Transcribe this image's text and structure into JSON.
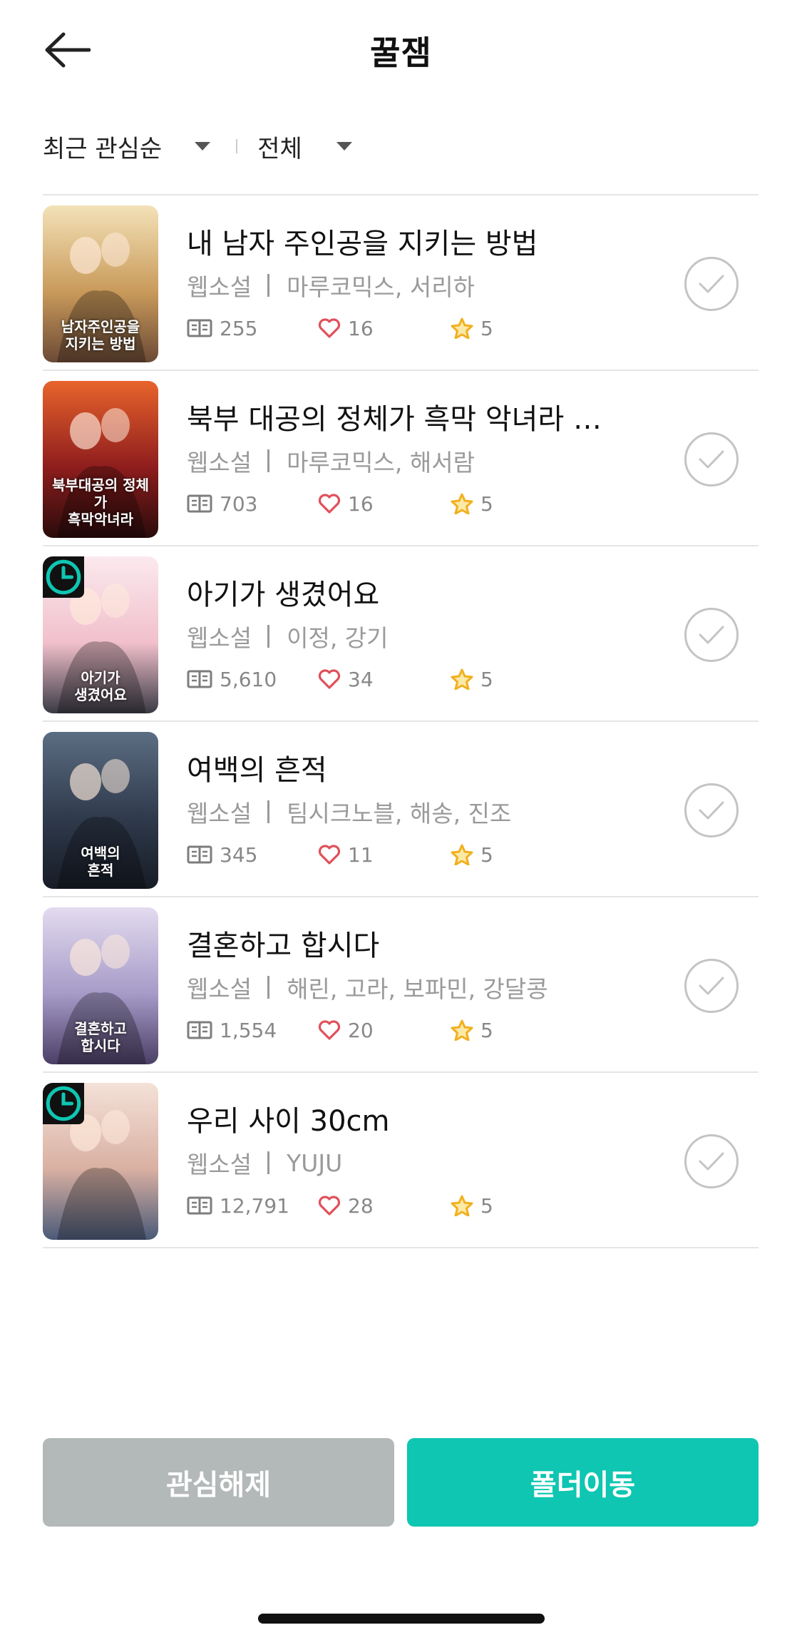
{
  "header": {
    "title": "꿀잼",
    "back_icon": "arrow-left-icon"
  },
  "filters": {
    "sort": "최근 관심순",
    "category": "전체"
  },
  "items": [
    {
      "title": "내 남자 주인공을 지키는 방법",
      "genre": "웹소설",
      "authors": "마루코믹스, 서리하",
      "views": "255",
      "likes": "16",
      "rating": "5",
      "cover_text": "남자주인공을\n지키는 방법",
      "cover_colors": [
        "#f3e2b8",
        "#c99a5a",
        "#6b4a36"
      ],
      "waitfree": false
    },
    {
      "title": "북부 대공의 정체가 흑막 악녀라 …",
      "genre": "웹소설",
      "authors": "마루코믹스, 해서람",
      "views": "703",
      "likes": "16",
      "rating": "5",
      "cover_text": "북부대공의 정체가\n흑막악녀라",
      "cover_colors": [
        "#e8642c",
        "#8e1d1d",
        "#2a0b0b"
      ],
      "waitfree": false
    },
    {
      "title": "아기가 생겼어요",
      "genre": "웹소설",
      "authors": "이정, 강기",
      "views": "5,610",
      "likes": "34",
      "rating": "5",
      "cover_text": "아기가\n생겼어요",
      "cover_colors": [
        "#fbe9ee",
        "#f1c0cc",
        "#3a3a44"
      ],
      "waitfree": true
    },
    {
      "title": "여백의 흔적",
      "genre": "웹소설",
      "authors": "팀시크노블, 해송, 진조",
      "views": "345",
      "likes": "11",
      "rating": "5",
      "cover_text": "여백의\n흔적",
      "cover_colors": [
        "#5c6d82",
        "#2f3a4c",
        "#171c26"
      ],
      "waitfree": false
    },
    {
      "title": "결혼하고 합시다",
      "genre": "웹소설",
      "authors": "해린, 고라, 보파민, 강달콩",
      "views": "1,554",
      "likes": "20",
      "rating": "5",
      "cover_text": "결혼하고\n합시다",
      "cover_colors": [
        "#e3dbef",
        "#a69bc8",
        "#4b3f66"
      ],
      "waitfree": false
    },
    {
      "title": "우리 사이 30cm",
      "genre": "웹소설",
      "authors": "YUJU",
      "views": "12,791",
      "likes": "28",
      "rating": "5",
      "cover_text": "",
      "cover_colors": [
        "#f4e1d8",
        "#d9b0a2",
        "#4a5a78"
      ],
      "waitfree": true
    }
  ],
  "actions": {
    "unfavorite": "관심해제",
    "move_folder": "폴더이동"
  },
  "colors": {
    "accent": "#0ec6b2",
    "disabled": "#b3b8b8",
    "heart": "#e0505a",
    "star": "#f2b01e"
  }
}
